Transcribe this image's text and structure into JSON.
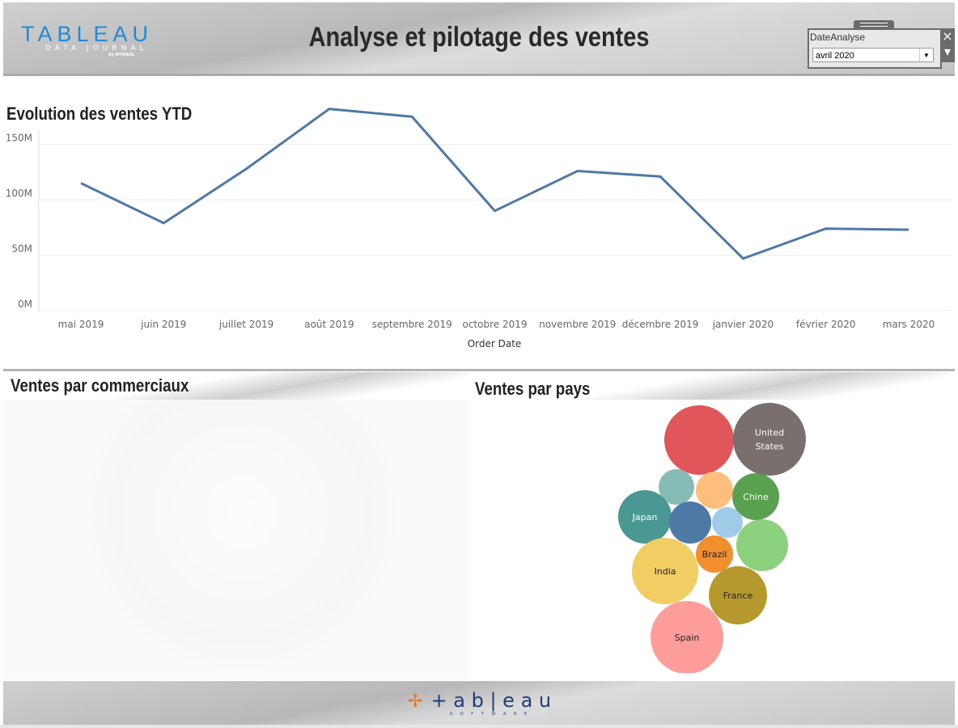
{
  "header": {
    "logo_text": "TABLEAU",
    "logo_sub": "DATA JOURNAL",
    "logo_by": "by MYDRAL",
    "title": "Analyse et pilotage des ventes"
  },
  "filter": {
    "label": "DateAnalyse",
    "value": "avril 2020",
    "close_icon": "×",
    "menu_icon": "▾"
  },
  "line_section": {
    "title": "Evolution des ventes YTD"
  },
  "chart_data": [
    {
      "type": "line",
      "title": "Evolution des ventes YTD",
      "xlabel": "Order Date",
      "ylabel": "",
      "categories": [
        "mai 2019",
        "juin 2019",
        "juillet 2019",
        "août 2019",
        "septembre 2019",
        "octobre 2019",
        "novembre 2019",
        "décembre 2019",
        "janvier 2020",
        "février 2020",
        "mars 2020"
      ],
      "values": [
        115,
        79,
        128,
        182,
        175,
        90,
        126,
        121,
        47,
        74,
        73
      ],
      "unit": "M",
      "yticks": [
        "0M",
        "50M",
        "100M",
        "150M"
      ],
      "ylim": [
        0,
        190
      ],
      "grid": true,
      "color": "#4e79a7"
    },
    {
      "type": "bubble",
      "title": "Ventes par pays",
      "bubbles": [
        {
          "label": "",
          "color": "#e15759"
        },
        {
          "label": "United States",
          "color": "#79706e"
        },
        {
          "label": "",
          "color": "#86bcb6"
        },
        {
          "label": "",
          "color": "#ffbe7d"
        },
        {
          "label": "Chine",
          "color": "#59a14f"
        },
        {
          "label": "Japan",
          "color": "#499894"
        },
        {
          "label": "",
          "color": "#4e79a7"
        },
        {
          "label": "",
          "color": "#a0cbe8"
        },
        {
          "label": "",
          "color": "#8cd17d"
        },
        {
          "label": "Brazil",
          "color": "#f28e2b"
        },
        {
          "label": "India",
          "color": "#f1ce63"
        },
        {
          "label": "France",
          "color": "#b6992d"
        },
        {
          "label": "Spain",
          "color": "#ff9d9a"
        }
      ]
    }
  ],
  "sections": {
    "commerciaux": "Ventes par commerciaux",
    "pays": "Ventes par pays"
  },
  "footer": {
    "logo_text": "+ a b | e a u",
    "logo_sub": "S O F T W A R E"
  }
}
